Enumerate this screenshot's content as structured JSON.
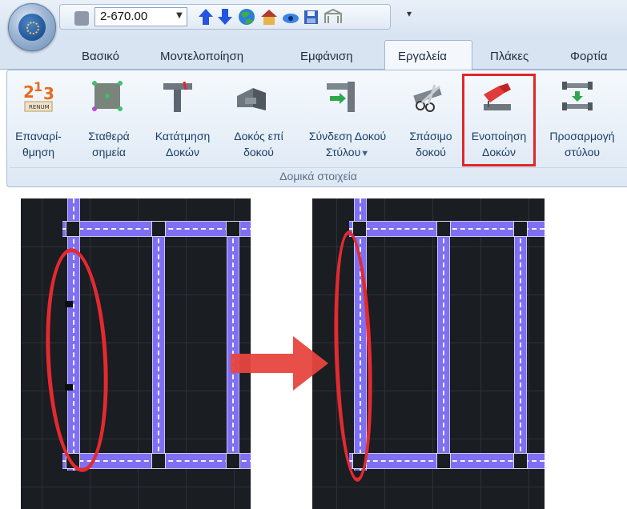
{
  "app": {
    "title": "",
    "quick_access": {
      "combo_value": "2-670.00",
      "icons": [
        "print-icon",
        "arrow-up-icon",
        "arrow-down-icon",
        "globe-icon",
        "house-icon",
        "eye-icon",
        "save-icon",
        "frame-icon"
      ],
      "more": "▾"
    }
  },
  "tabs": [
    "Βασικό",
    "Μοντελοποίηση",
    "Εμφάνιση",
    "Εργαλεία",
    "Πλάκες",
    "Φορτία"
  ],
  "active_tab": "Εργαλεία",
  "ribbon": {
    "group_label": "Δομικά στοιχεία",
    "buttons": [
      {
        "line1": "Επαναρί-",
        "line2": "θμηση"
      },
      {
        "line1": "Σταθερά",
        "line2": "σημεία"
      },
      {
        "line1": "Κατάτμηση",
        "line2": "Δοκών"
      },
      {
        "line1": "Δοκός επί",
        "line2": "δοκού"
      },
      {
        "line1": "Σύνδεση Δοκού",
        "line2": "Στύλου"
      },
      {
        "line1": "Σπάσιμο",
        "line2": "δοκού"
      },
      {
        "line1": "Ενοποίηση",
        "line2": "Δοκών"
      },
      {
        "line1": "Προσαρμογή",
        "line2": "στύλου"
      }
    ],
    "renumber_icon_text": {
      "a": "2",
      "b": "1",
      "c": "3",
      "tag": "RENUM"
    },
    "highlighted": "Ενοποίηση Δοκών",
    "colors": {
      "highlight": "#e0262b",
      "beam": "#7e6ff3",
      "canvas": "#1a1d22",
      "arrow": "#e8463f"
    }
  }
}
